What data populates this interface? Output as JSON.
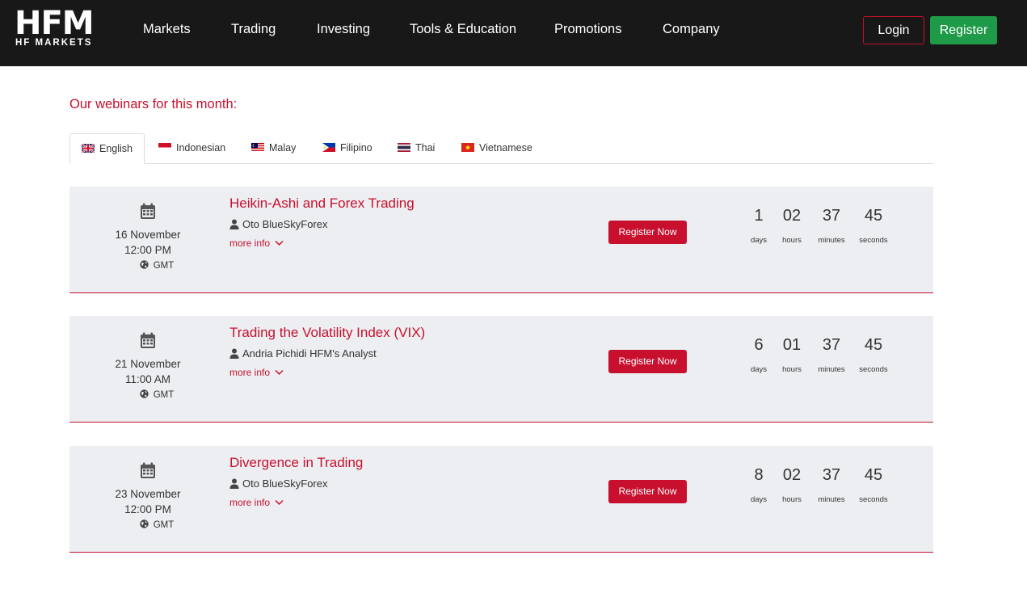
{
  "header": {
    "logo_text": "HFM",
    "logo_subtitle": "HF MARKETS",
    "nav": [
      "Markets",
      "Trading",
      "Investing",
      "Tools & Education",
      "Promotions",
      "Company"
    ],
    "login_label": "Login",
    "register_label": "Register"
  },
  "section_title": "Our webinars for this month:",
  "tabs": [
    {
      "label": "English",
      "flag": "uk-flag-icon",
      "active": true
    },
    {
      "label": "Indonesian",
      "flag": "indonesia-flag-icon",
      "active": false
    },
    {
      "label": "Malay",
      "flag": "malaysia-flag-icon",
      "active": false
    },
    {
      "label": "Filipino",
      "flag": "philippines-flag-icon",
      "active": false
    },
    {
      "label": "Thai",
      "flag": "thailand-flag-icon",
      "active": false
    },
    {
      "label": "Vietnamese",
      "flag": "vietnam-flag-icon",
      "active": false
    }
  ],
  "webinars": [
    {
      "date": "16 November",
      "time": "12:00 PM",
      "timezone": "GMT",
      "title": "Heikin-Ashi and Forex Trading",
      "presenter": "Oto BlueSkyForex",
      "more_info": "more info",
      "register_label": "Register Now",
      "countdown": {
        "days": "1",
        "hours": "02",
        "minutes": "37",
        "seconds": "45"
      }
    },
    {
      "date": "21 November",
      "time": "11:00 AM",
      "timezone": "GMT",
      "title": "Trading the Volatility Index (VIX)",
      "presenter": "Andria Pichidi HFM's Analyst",
      "more_info": "more info",
      "register_label": "Register Now",
      "countdown": {
        "days": "6",
        "hours": "01",
        "minutes": "37",
        "seconds": "45"
      }
    },
    {
      "date": "23 November",
      "time": "12:00 PM",
      "timezone": "GMT",
      "title": "Divergence in Trading",
      "presenter": "Oto BlueSkyForex",
      "more_info": "more info",
      "register_label": "Register Now",
      "countdown": {
        "days": "8",
        "hours": "02",
        "minutes": "37",
        "seconds": "45"
      }
    }
  ],
  "countdown_labels": {
    "days": "days",
    "hours": "hours",
    "minutes": "minutes",
    "seconds": "seconds"
  },
  "colors": {
    "brand_red": "#c8102e",
    "register_green": "#1e9a48",
    "header_bg": "#181818",
    "card_bg": "#eceef1"
  }
}
